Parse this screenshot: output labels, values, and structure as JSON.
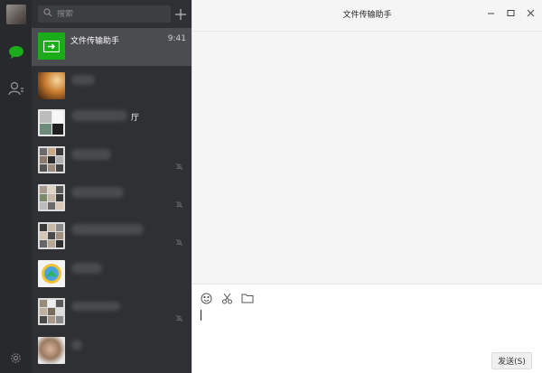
{
  "window": {
    "title": "文件传输助手"
  },
  "search": {
    "placeholder": "搜索"
  },
  "chats": [
    {
      "name": "文件传输助手",
      "time": "9:41",
      "active": true
    },
    {
      "name": "",
      "time": "",
      "active": false
    },
    {
      "name": "厅",
      "time": "",
      "active": false
    },
    {
      "name": "",
      "time": "",
      "active": false
    },
    {
      "name": "",
      "time": "",
      "active": false
    },
    {
      "name": "",
      "time": "",
      "active": false
    },
    {
      "name": "",
      "time": "",
      "active": false
    },
    {
      "name": "",
      "time": "",
      "active": false
    },
    {
      "name": "",
      "time": "",
      "active": false
    }
  ],
  "composer": {
    "send_label": "发送(S)"
  },
  "colors": {
    "accent": "#1aad19",
    "sidebar": "#28292c",
    "list": "#2f3033"
  },
  "icons": [
    "chat-icon",
    "contacts-icon",
    "settings-icon",
    "search-icon",
    "plus-icon",
    "emoji-icon",
    "scissors-icon",
    "folder-icon",
    "mute-icon"
  ]
}
